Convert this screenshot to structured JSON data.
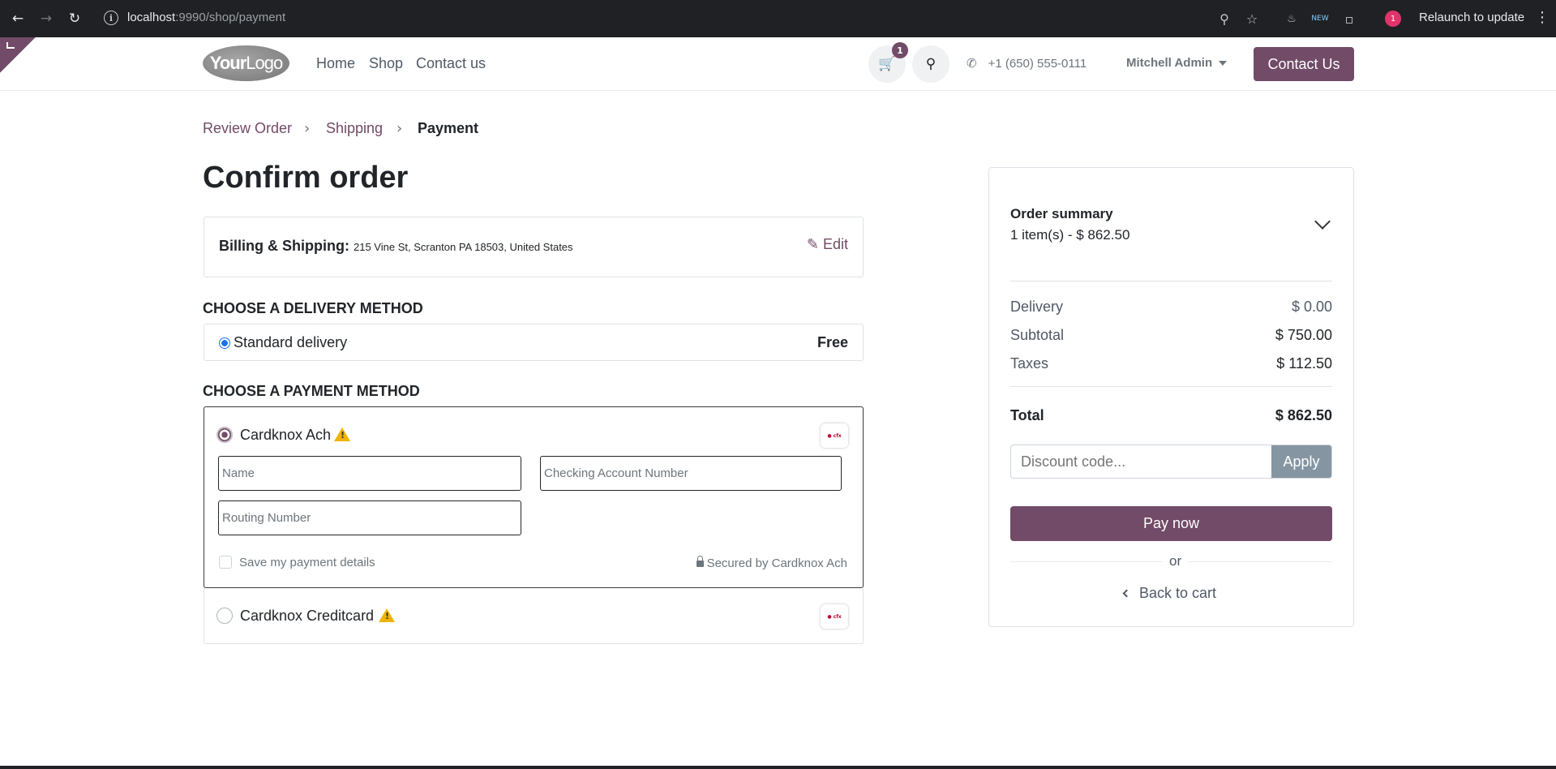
{
  "browser": {
    "url_host": "localhost",
    "url_rest": ":9990/shop/payment",
    "relaunch": "Relaunch to update",
    "profile_badge": "1"
  },
  "header": {
    "logo_your": "Your",
    "logo_logo": "Logo",
    "nav": [
      "Home",
      "Shop",
      "Contact us"
    ],
    "cart_count": "1",
    "phone": "+1 (650) 555-0111",
    "user": "Mitchell Admin",
    "contact_button": "Contact Us",
    "accent_color": "#714b67"
  },
  "breadcrumb": {
    "review": "Review Order",
    "shipping": "Shipping",
    "payment": "Payment"
  },
  "page_title": "Confirm order",
  "billing": {
    "label": "Billing & Shipping:",
    "address": "215 Vine St, Scranton PA 18503, United States",
    "edit": "Edit"
  },
  "delivery": {
    "heading": "CHOOSE A DELIVERY METHOD",
    "method": "Standard delivery",
    "price": "Free"
  },
  "payment": {
    "heading": "CHOOSE A PAYMENT METHOD",
    "option1": "Cardknox Ach",
    "option2": "Cardknox Creditcard",
    "name_placeholder": "Name",
    "account_placeholder": "Checking Account Number",
    "routing_placeholder": "Routing Number",
    "save_details": "Save my payment details",
    "secured": "Secured by Cardknox Ach"
  },
  "summary": {
    "title": "Order summary",
    "items": "1 item(s) -  $ 862.50",
    "delivery_label": "Delivery",
    "delivery_value": "$ 0.00",
    "subtotal_label": "Subtotal",
    "subtotal_value": "$ 750.00",
    "taxes_label": "Taxes",
    "taxes_value": "$ 112.50",
    "total_label": "Total",
    "total_value": "$ 862.50",
    "discount_placeholder": "Discount code...",
    "apply": "Apply",
    "pay_now": "Pay now",
    "or": "or",
    "back_to_cart": "Back to cart"
  }
}
